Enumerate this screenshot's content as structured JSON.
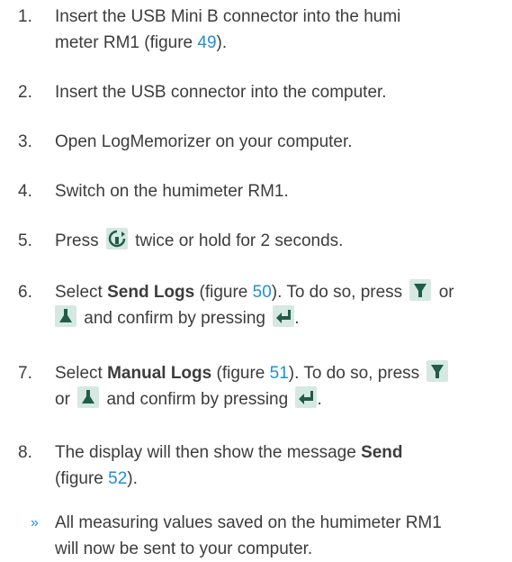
{
  "steps": [
    {
      "num": "1.",
      "line1_a": "Insert the USB Mini B connector into the humi",
      "line2_a": "meter RM1 (figure ",
      "line2_link": "49",
      "line2_b": ")."
    },
    {
      "num": "2.",
      "text": "Insert the USB connector into the computer."
    },
    {
      "num": "3.",
      "text": "Open LogMemorizer on your computer."
    },
    {
      "num": "4.",
      "text": "Switch on the humimeter RM1."
    },
    {
      "num": "5.",
      "a": "Press ",
      "icon": "rotate-arrow-icon",
      "b": " twice or hold for 2 seconds."
    },
    {
      "num": "6.",
      "a": "Select ",
      "bold": "Send Logs",
      "b": " (figure ",
      "link": "50",
      "c": "). To do so, press ",
      "d": " or",
      "e": " and confirm by pressing ",
      "f": "."
    },
    {
      "num": "7.",
      "a": "Select ",
      "bold": "Manual Logs",
      "b": " (figure ",
      "link": "51",
      "c": "). To do so, press ",
      "d": "or ",
      "e": " and confirm by pressing ",
      "f": "."
    },
    {
      "num": "8.",
      "a": "The display will then show the message ",
      "bold": "Send",
      "b": "(figure ",
      "link": "52",
      "c": ")."
    }
  ],
  "result": {
    "marker": "»",
    "line1": "All measuring values saved on the humimeter RM1",
    "line2": "will now be sent to your computer."
  },
  "colors": {
    "text": "#3c3c3c",
    "link": "#1f8fd6",
    "icon_bg": "#d6e8e2",
    "icon_fg": "#1f5c4a"
  }
}
